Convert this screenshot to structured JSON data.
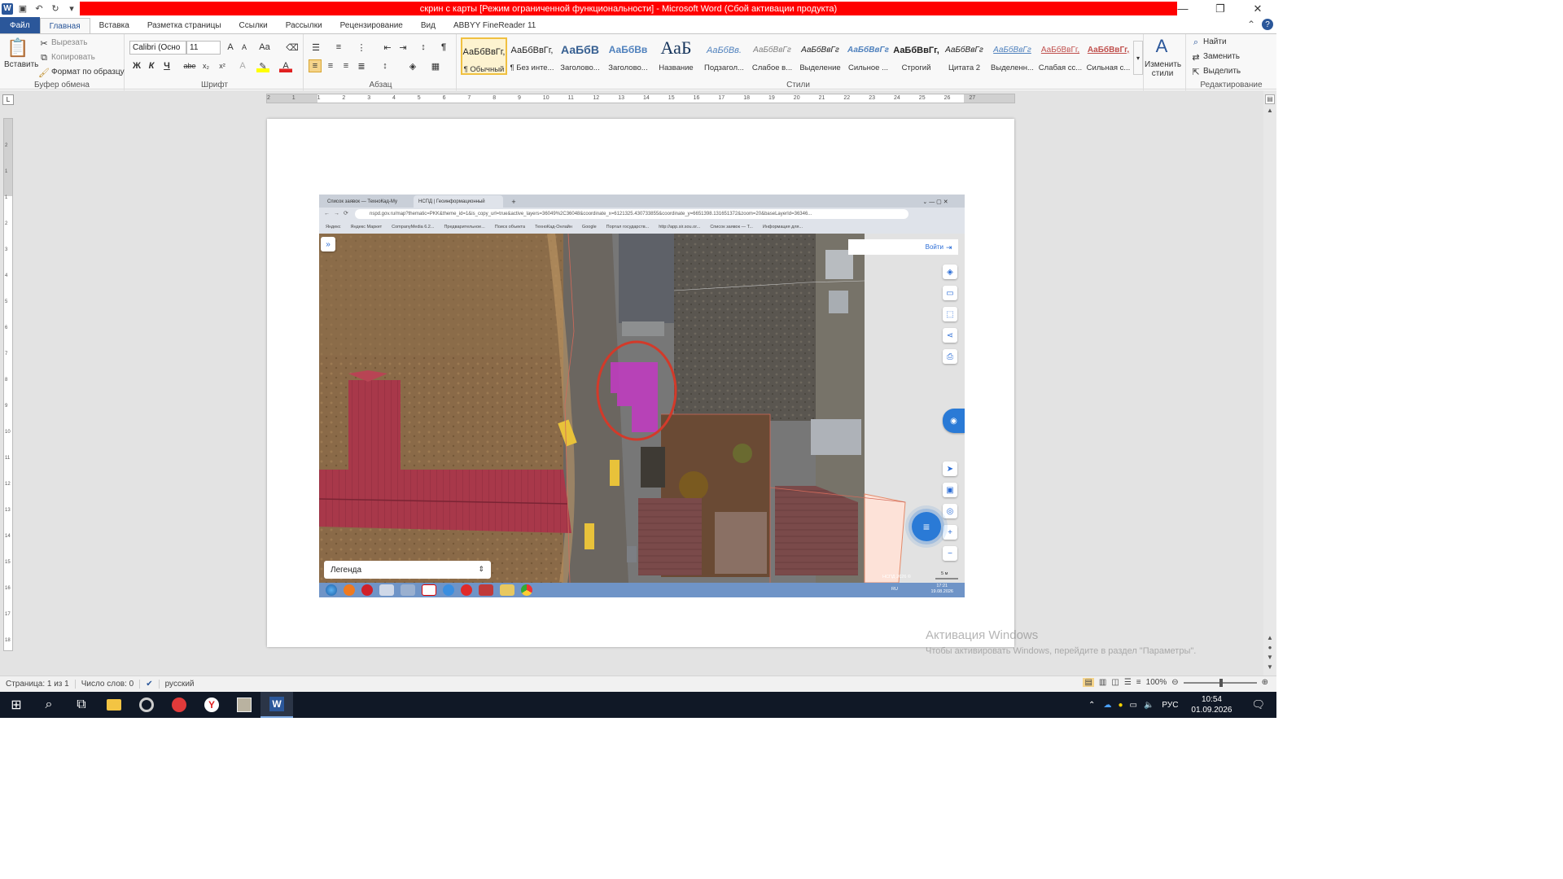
{
  "window": {
    "title": "скрин с карты [Режим ограниченной функциональности]  -  Microsoft Word (Сбой активации продукта)",
    "app_letter": "W"
  },
  "ribbon_tabs": [
    "Файл",
    "Главная",
    "Вставка",
    "Разметка страницы",
    "Ссылки",
    "Рассылки",
    "Рецензирование",
    "Вид",
    "ABBYY FineReader 11"
  ],
  "clipboard": {
    "paste": "Вставить",
    "cut": "Вырезать",
    "copy": "Копировать",
    "format_painter": "Формат по образцу",
    "label": "Буфер обмена"
  },
  "font": {
    "name": "Calibri (Осно",
    "size": "11",
    "label": "Шрифт",
    "bold": "Ж",
    "italic": "К",
    "underline": "Ч",
    "strike": "abe"
  },
  "paragraph": {
    "label": "Абзац"
  },
  "styles": {
    "label": "Стили",
    "items": [
      {
        "sample": "АаБбВвГг,",
        "name": "¶ Обычный"
      },
      {
        "sample": "АаБбВвГг,",
        "name": "¶ Без инте..."
      },
      {
        "sample": "АаБбВ",
        "name": "Заголово..."
      },
      {
        "sample": "АаБбВв",
        "name": "Заголово..."
      },
      {
        "sample": "АаБ",
        "name": "Название"
      },
      {
        "sample": "АаБбВв.",
        "name": "Подзагол..."
      },
      {
        "sample": "АаБбВвГг",
        "name": "Слабое в..."
      },
      {
        "sample": "АаБбВвГг",
        "name": "Выделение"
      },
      {
        "sample": "АаБбВвГг",
        "name": "Сильное ..."
      },
      {
        "sample": "АаБбВвГг,",
        "name": "Строгий"
      },
      {
        "sample": "АаБбВвГг",
        "name": "Цитата 2"
      },
      {
        "sample": "АаБбВвГг",
        "name": "Выделенн..."
      },
      {
        "sample": "АаБбВвГг,",
        "name": "Слабая сс..."
      },
      {
        "sample": "АаБбВвГг,",
        "name": "Сильная с..."
      }
    ],
    "change_styles": "Изменить стили"
  },
  "editing": {
    "find": "Найти",
    "replace": "Заменить",
    "select": "Выделить",
    "label": "Редактирование"
  },
  "ruler_numbers": [
    "2",
    "1",
    "1",
    "2",
    "3",
    "4",
    "5",
    "6",
    "7",
    "8",
    "9",
    "10",
    "11",
    "12",
    "13",
    "14",
    "15",
    "16",
    "17",
    "18",
    "19",
    "20",
    "21",
    "22",
    "23",
    "24",
    "25",
    "26",
    "27"
  ],
  "vruler_numbers": [
    "2",
    "1",
    "1",
    "2",
    "3",
    "4",
    "5",
    "6",
    "7",
    "8",
    "9",
    "10",
    "11",
    "12",
    "13",
    "14",
    "15",
    "16",
    "17",
    "18"
  ],
  "embedded": {
    "tab1": "Список заявок — ТехноКад-Му",
    "tab2": "НСПД | Геоинформационный",
    "url": "nspd.gov.ru/map?thematic=PKK&theme_id=1&is_copy_url=true&active_layers=36049%2C36048&coordinate_x=6121325.430733855&coordinate_y=6651398.131651372&zoom=20&baseLayerId=36346...",
    "bookmarks": [
      "Яндекс",
      "Яндекс Маркет",
      "CompanyMedia 6.2...",
      "Предварительное...",
      "Поиск объекта",
      "ТехноКад-Онлайн",
      "Google",
      "Портал государств...",
      "http://app.sir.sou.or...",
      "Список заявок — Т...",
      "Информация для..."
    ],
    "login": "Войти",
    "legend": "Легенда",
    "copyright": "НСПД 2026 ©",
    "scale": "5 м",
    "lang": "RU",
    "time": "17:21",
    "date": "19.08.2026"
  },
  "watermark": {
    "line1": "Активация Windows",
    "line2": "Чтобы активировать Windows, перейдите в раздел \"Параметры\"."
  },
  "status": {
    "page": "Страница: 1 из 1",
    "words": "Число слов: 0",
    "lang": "русский",
    "zoom": "100%"
  },
  "taskbar": {
    "lang": "РУС",
    "time": "10:54",
    "date": "01.09.2026"
  },
  "colors": {
    "word_blue": "#2b579a",
    "title_red": "#ff0000",
    "parcel_magenta": "#c03bc0",
    "circle_red": "#d23a2a"
  }
}
